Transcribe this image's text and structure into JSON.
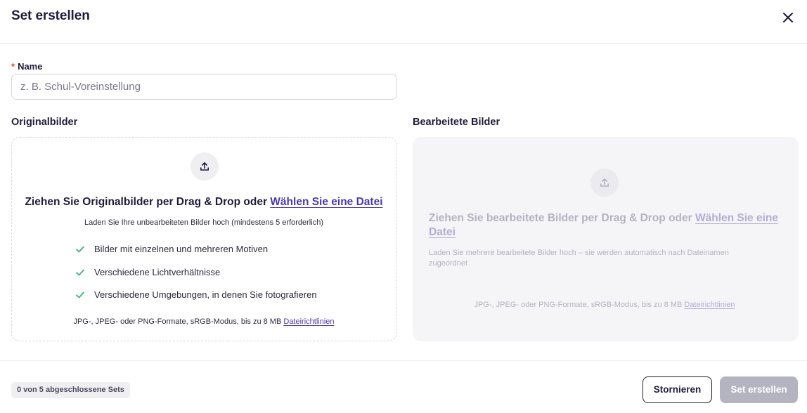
{
  "dialog": {
    "title": "Set erstellen"
  },
  "name_field": {
    "required_mark": "*",
    "label": "Name",
    "value": "",
    "placeholder": "z. B. Schul-Voreinstellung"
  },
  "original": {
    "label": "Originalbilder",
    "drop_title": "Ziehen Sie Originalbilder per Drag & Drop oder",
    "choose_link": "Wählen Sie eine Datei",
    "subtitle": "Laden Sie Ihre unbearbeiteten Bilder hoch (mindestens 5 erforderlich)",
    "checklist": [
      "Bilder mit einzelnen und mehreren Motiven",
      "Verschiedene Lichtverhältnisse",
      "Verschiedene Umgebungen, in denen Sie fotografieren"
    ],
    "formats": "JPG-, JPEG- oder PNG-Formate, sRGB-Modus, bis zu 8 MB",
    "guidelines_link": "Dateirichtlinien",
    "upload_icon": "upload-icon",
    "check_icon": "check-icon",
    "check_color": "#3db37a"
  },
  "edited": {
    "label": "Bearbeitete Bilder",
    "drop_title": "Ziehen Sie bearbeitete Bilder per Drag & Drop oder",
    "choose_link": "Wählen Sie eine Datei",
    "subtitle": "Laden Sie mehrere bearbeitete Bilder hoch – sie werden automatisch nach Dateinamen zugeordnet",
    "formats": "JPG-, JPEG- oder PNG-Formate, sRGB-Modus, bis zu 8 MB",
    "guidelines_link": "Dateirichtlinien",
    "upload_icon": "upload-icon",
    "disabled": true
  },
  "footer": {
    "progress_badge": "0 von 5 abgeschlossene Sets",
    "cancel_label": "Stornieren",
    "create_label": "Set erstellen"
  },
  "colors": {
    "accent_link": "#4a3aa8",
    "text_dark": "#1f1d3a",
    "required": "#e5484d",
    "disabled_button": "#b4b3c0"
  }
}
